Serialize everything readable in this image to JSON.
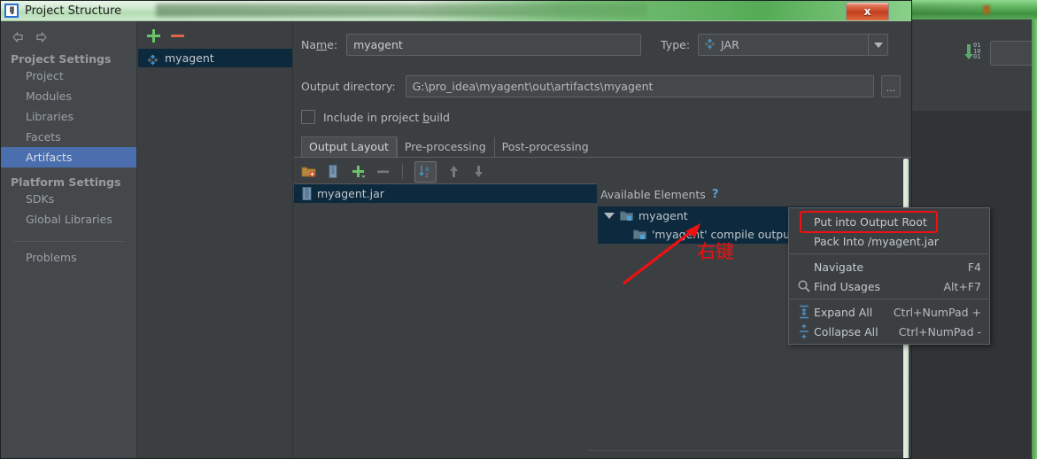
{
  "window": {
    "title": "Project Structure",
    "app_icon": "intellij-idea-icon",
    "close_label": "x"
  },
  "sidebar": {
    "nav": {
      "back": "back-arrow",
      "forward": "forward-arrow"
    },
    "groups": [
      {
        "title": "Project Settings",
        "items": [
          {
            "label": "Project",
            "selected": false
          },
          {
            "label": "Modules",
            "selected": false
          },
          {
            "label": "Libraries",
            "selected": false
          },
          {
            "label": "Facets",
            "selected": false
          },
          {
            "label": "Artifacts",
            "selected": true
          }
        ]
      },
      {
        "title": "Platform Settings",
        "items": [
          {
            "label": "SDKs",
            "selected": false
          },
          {
            "label": "Global Libraries",
            "selected": false
          }
        ]
      }
    ],
    "problems": "Problems"
  },
  "artifact_list": {
    "add_label": "+",
    "remove_label": "−",
    "items": [
      {
        "label": "myagent",
        "icon": "artifact-diamond-icon",
        "selected": true
      }
    ]
  },
  "form": {
    "name_label": "Name:",
    "name_value": "myagent",
    "type_label": "Type:",
    "type_value": "JAR",
    "output_dir_label": "Output directory:",
    "output_dir_value": "G:\\pro_idea\\myagent\\out\\artifacts\\myagent",
    "browse_label": "...",
    "include_checkbox_label": "Include in project build",
    "include_checked": false
  },
  "tabs": [
    {
      "label": "Output Layout",
      "active": true
    },
    {
      "label": "Pre-processing",
      "active": false
    },
    {
      "label": "Post-processing",
      "active": false
    }
  ],
  "layout_toolbar": [
    {
      "name": "add-directory-icon"
    },
    {
      "name": "add-archive-icon"
    },
    {
      "name": "add-copy-icon"
    },
    {
      "name": "remove-icon"
    },
    {
      "name": "sort-alphabetically-icon"
    },
    {
      "name": "move-up-icon"
    },
    {
      "name": "move-down-icon"
    }
  ],
  "output_tree": {
    "rows": [
      {
        "label": "myagent.jar",
        "icon": "jar-icon",
        "selected": true,
        "indent": 0
      }
    ]
  },
  "available_elements": {
    "header": "Available Elements",
    "help": "?",
    "rows": [
      {
        "label": "myagent",
        "icon": "module-folder-icon",
        "indent": 0,
        "expanded": true,
        "selected": true
      },
      {
        "label": "'myagent' compile output",
        "icon": "compile-output-icon",
        "indent": 1,
        "expanded": false,
        "selected": true
      }
    ]
  },
  "context_menu": {
    "items": [
      {
        "label": "Put into Output Root",
        "shortcut": "",
        "icon": "",
        "highlighted": true
      },
      {
        "label": "Pack Into /myagent.jar",
        "shortcut": "",
        "icon": ""
      },
      {
        "separator": true
      },
      {
        "label": "Navigate",
        "shortcut": "F4",
        "icon": ""
      },
      {
        "label": "Find Usages",
        "shortcut": "Alt+F7",
        "icon": "find-usages-icon"
      },
      {
        "separator": true
      },
      {
        "label": "Expand All",
        "shortcut": "Ctrl+NumPad +",
        "icon": "expand-all-icon"
      },
      {
        "label": "Collapse All",
        "shortcut": "Ctrl+NumPad -",
        "icon": "collapse-all-icon"
      }
    ]
  },
  "annotation": {
    "text": "右键",
    "color": "#ee1111",
    "arrow": "red-arrow-pointing-up-right"
  },
  "colors": {
    "accent_selection": "#4b6eaf",
    "tree_selection": "#0d293e",
    "panel_bg": "#3c3f41",
    "sidebar_bg": "#45484a",
    "annotation_red": "#ee1111",
    "add_green": "#6ac46a",
    "remove_red": "#d9654a"
  }
}
